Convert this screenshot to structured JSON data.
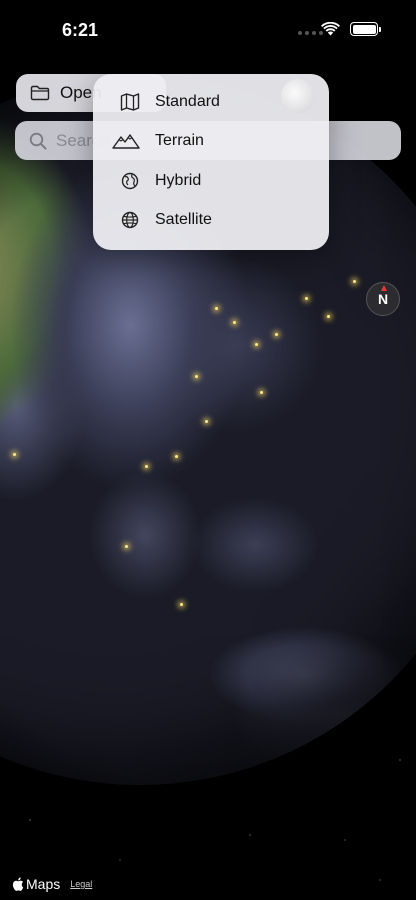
{
  "status_bar": {
    "time": "6:21"
  },
  "open_button": {
    "label": "Open"
  },
  "search": {
    "placeholder": "Search"
  },
  "map_type_menu": {
    "items": [
      {
        "label": "Standard",
        "icon": "map-icon"
      },
      {
        "label": "Terrain",
        "icon": "mountains-icon"
      },
      {
        "label": "Hybrid",
        "icon": "globe-hybrid-icon"
      },
      {
        "label": "Satellite",
        "icon": "globe-icon"
      }
    ]
  },
  "compass": {
    "letter": "N"
  },
  "footer": {
    "brand": "Maps",
    "legal": "Legal"
  }
}
